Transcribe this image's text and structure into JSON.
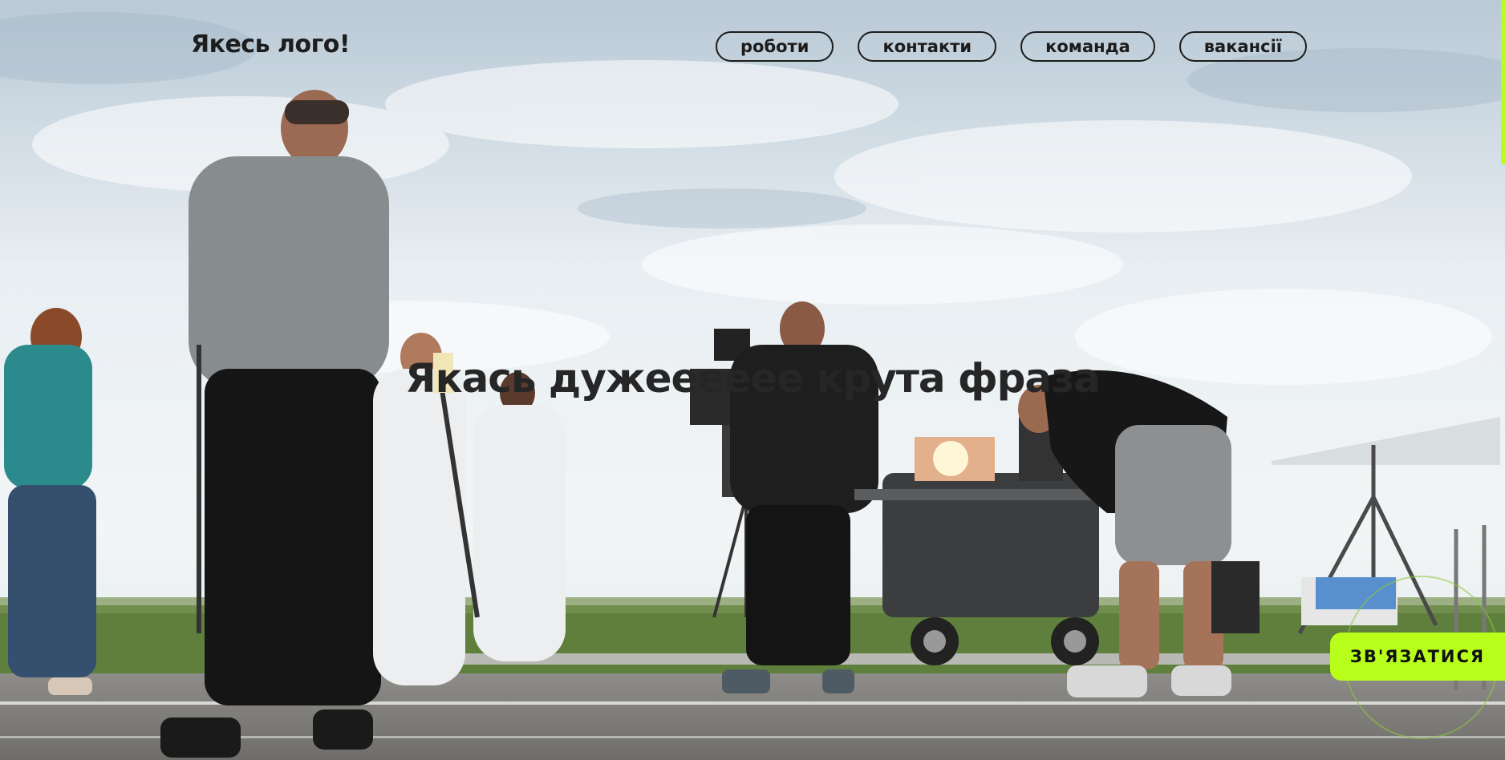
{
  "header": {
    "logo": "Якесь лого!",
    "nav": [
      {
        "label": "роботи"
      },
      {
        "label": "контакти"
      },
      {
        "label": "команда"
      },
      {
        "label": "вакансії"
      }
    ]
  },
  "hero": {
    "headline": "Якась дужееееее крута фраза"
  },
  "cta": {
    "label": "ЗВ'ЯЗАТИСЯ"
  },
  "colors": {
    "accent": "#b7ff1a",
    "text": "#1c1c1c"
  }
}
